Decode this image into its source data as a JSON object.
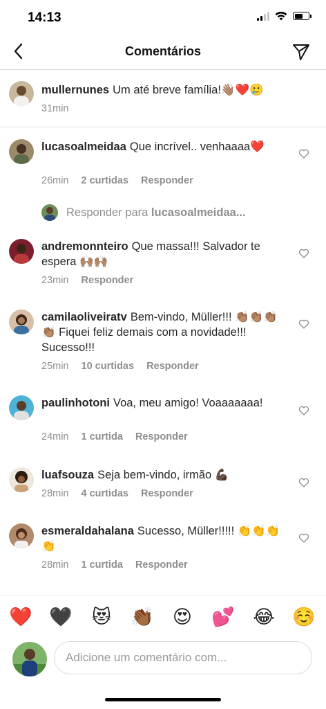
{
  "status_bar": {
    "time": "14:13",
    "battery_level": 0.6
  },
  "header": {
    "title": "Comentários",
    "back_icon": "chevron-left-icon",
    "send_icon": "paper-plane-icon"
  },
  "caption": {
    "username": "mullernunes",
    "text": "Um até breve família!👋🏽❤️🥲",
    "time": "31min"
  },
  "comments": [
    {
      "username": "lucasoalmeidaa",
      "text": "Que incrível.. venhaaaa❤️",
      "time": "26min",
      "likes": "2 curtidas",
      "reply": "Responder"
    },
    {
      "username": "andremonnteiro",
      "text": "Que massa!!! Salvador te espera 🙌🏽🙌🏽",
      "time": "23min",
      "likes": "",
      "reply": "Responder"
    },
    {
      "username": "camilaoliveiratv",
      "text": "Bem-vindo, Müller!!! 👏🏽👏🏽👏🏽👏🏽 Fiquei feliz demais com a novidade!!! Sucesso!!!",
      "time": "25min",
      "likes": "10 curtidas",
      "reply": "Responder"
    },
    {
      "username": "paulinhotoni",
      "text": "Voa, meu amigo! Voaaaaaaa!",
      "time": "24min",
      "likes": "1 curtida",
      "reply": "Responder"
    },
    {
      "username": "luafsouza",
      "text": "Seja bem-vindo, irmão 💪🏿",
      "time": "28min",
      "likes": "4 curtidas",
      "reply": "Responder"
    },
    {
      "username": "esmeraldahalana",
      "text": "Sucesso, Müller!!!!! 👏👏👏👏",
      "time": "28min",
      "likes": "1 curtida",
      "reply": "Responder"
    }
  ],
  "reply_prompt": {
    "prefix": "Responder para",
    "username": "lucasoalmeidaa..."
  },
  "quick_reactions": [
    "❤️",
    "🖤",
    "😻",
    "👏🏾",
    "😍",
    "💕",
    "😂",
    "☺️"
  ],
  "composer": {
    "placeholder": "Adicione um comentário com..."
  },
  "colors": {
    "text": "#262626",
    "muted": "#8e8e8e",
    "divider": "#dbdbdb"
  }
}
